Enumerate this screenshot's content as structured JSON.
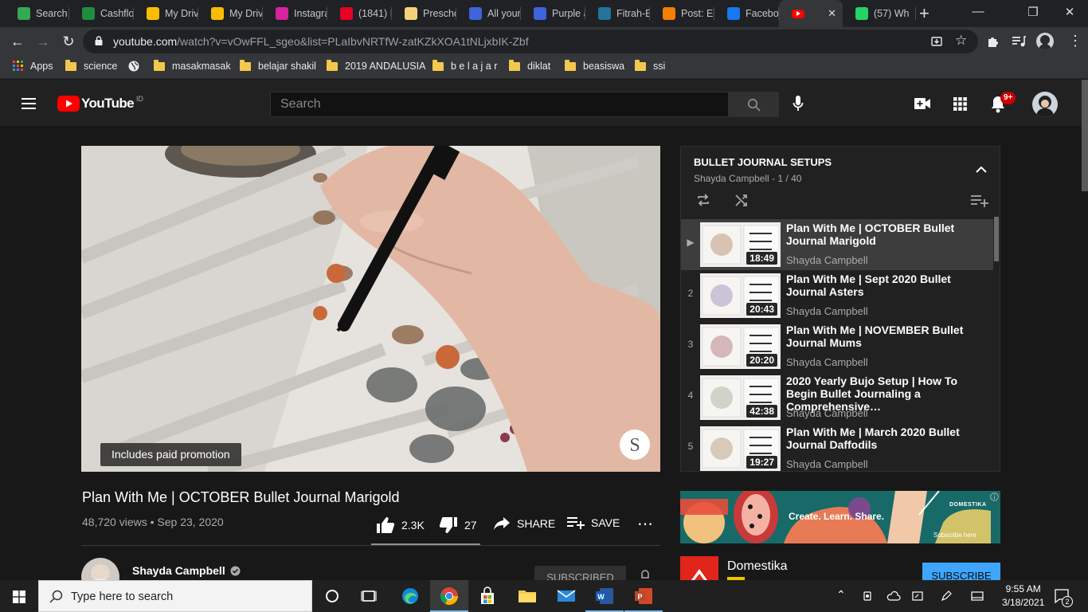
{
  "browser": {
    "tabs": [
      {
        "label": "Search",
        "color": "#34a853",
        "icon": "google-drive-icon"
      },
      {
        "label": "Cashflo",
        "color": "#1e8e3e",
        "icon": "google-sheets-icon"
      },
      {
        "label": "My Driv",
        "color": "#fbbc04",
        "icon": "google-drive-icon"
      },
      {
        "label": "My Driv",
        "color": "#fbbc04",
        "icon": "google-drive-icon"
      },
      {
        "label": "Instagra",
        "color": "#d6249f",
        "icon": "instagram-icon"
      },
      {
        "label": "(1841) I",
        "color": "#e60023",
        "icon": "pinterest-icon"
      },
      {
        "label": "Prescho",
        "color": "#f4d27a",
        "icon": "book-icon"
      },
      {
        "label": "All your",
        "color": "#3e63dd",
        "icon": "canva-icon"
      },
      {
        "label": "Purple a",
        "color": "#3e63dd",
        "icon": "canva-icon"
      },
      {
        "label": "Fitrah-E",
        "color": "#21759b",
        "icon": "wordpress-icon"
      },
      {
        "label": "Post: Ed",
        "color": "#f57d00",
        "icon": "blogger-icon"
      },
      {
        "label": "Faceboo",
        "color": "#1877f2",
        "icon": "facebook-icon"
      },
      {
        "label": "",
        "color": "#ff0000",
        "icon": "youtube-icon",
        "active": true
      },
      {
        "label": "(57) Wh",
        "color": "#25d366",
        "icon": "whatsapp-icon"
      }
    ],
    "url_host": "youtube.com",
    "url_path": "/watch?v=vOwFFL_sgeo&list=PLaIbvNRTfW-zatKZkXOA1tNLjxbIK-Zbf",
    "bookmarks": [
      "Apps",
      "science",
      "",
      "masakmasak",
      "belajar shakil",
      "2019 ANDALUSIA",
      "b e l a j a r",
      "diklat",
      "beasiswa",
      "ssi"
    ]
  },
  "youtube": {
    "logo_text": "YouTube",
    "logo_region": "ID",
    "search_placeholder": "Search",
    "notification_count": "9+",
    "promo_label": "Includes paid promotion",
    "video_title": "Plan With Me | OCTOBER Bullet Journal Marigold",
    "views": "48,720 views",
    "date": "Sep 23, 2020",
    "likes": "2.3K",
    "dislikes": "27",
    "share_label": "SHARE",
    "save_label": "SAVE",
    "channel_name": "Shayda Campbell",
    "subscribed_label": "SUBSCRIBED"
  },
  "playlist": {
    "title": "BULLET JOURNAL SETUPS",
    "subtitle": "Shayda Campbell - 1 / 40",
    "items": [
      {
        "num": "▶",
        "title": "Plan With Me | OCTOBER Bullet Journal Marigold",
        "channel": "Shayda Campbell",
        "duration": "18:49",
        "active": true
      },
      {
        "num": "2",
        "title": "Plan With Me | Sept 2020 Bullet Journal Asters",
        "channel": "Shayda Campbell",
        "duration": "20:43"
      },
      {
        "num": "3",
        "title": "Plan With Me | NOVEMBER Bullet Journal Mums",
        "channel": "Shayda Campbell",
        "duration": "20:20"
      },
      {
        "num": "4",
        "title": "2020 Yearly Bujo Setup | How To Begin Bullet Journaling a Comprehensive…",
        "channel": "Shayda Campbell",
        "duration": "42:38"
      },
      {
        "num": "5",
        "title": "Plan With Me | March 2020 Bullet Journal Daffodils",
        "channel": "Shayda Campbell",
        "duration": "19:27"
      }
    ]
  },
  "ad": {
    "banner_text": "Create. Learn. Share.",
    "banner_brand": "DOMESTIKA",
    "banner_cta": "Subscribe here",
    "advertiser": "Domestika",
    "cta": "SUBSCRIBE"
  },
  "taskbar": {
    "search_placeholder": "Type here to search",
    "time": "9:55 AM",
    "date": "3/18/2021",
    "notifications": "2"
  }
}
